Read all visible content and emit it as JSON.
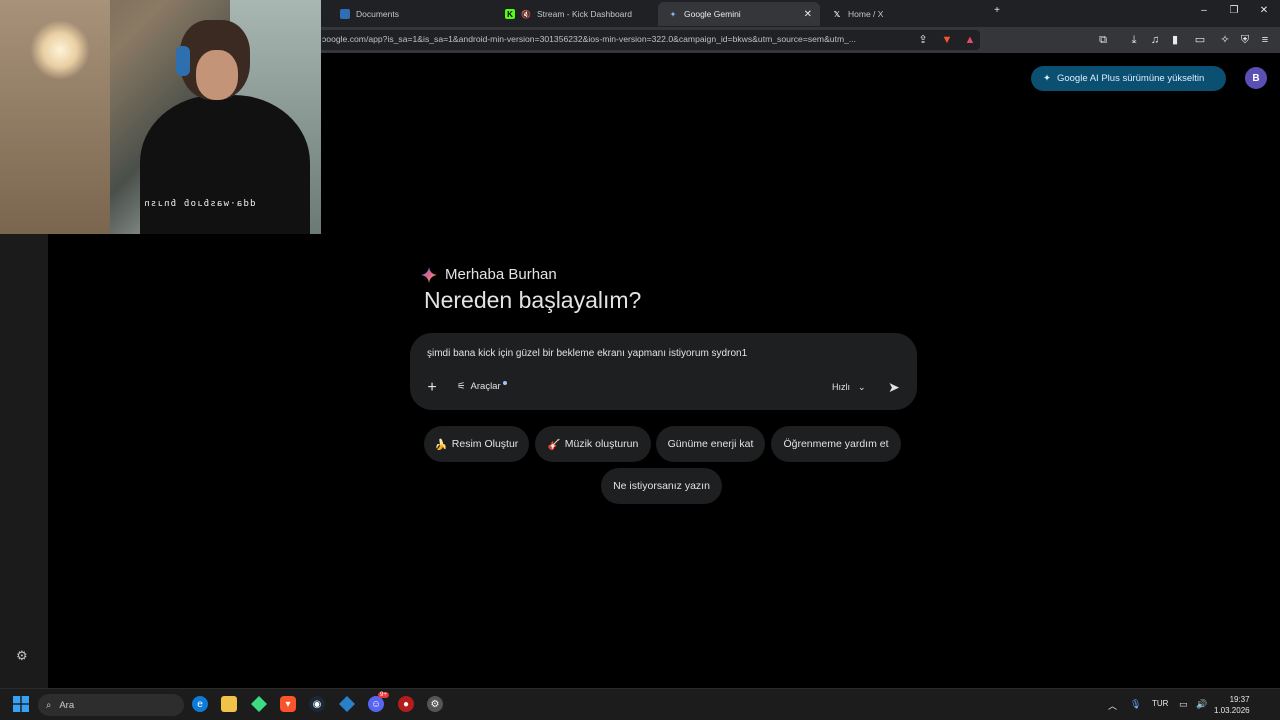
{
  "tabs": [
    {
      "label": "Documents",
      "active": false
    },
    {
      "label": "Stream - Kick Dashboard",
      "active": false
    },
    {
      "label": "Google Gemini",
      "active": true
    },
    {
      "label": "Home / X",
      "active": false
    }
  ],
  "window_controls": {
    "new_tab": "+",
    "minimize": "–",
    "restore": "❐",
    "close": "✕"
  },
  "address_bar": {
    "url": "ɔoogle.com/app?is_sa=1&is_sa=1&android-min-version=301356232&ios-min-version=322.0&campaign_id=bkws&utm_source=sem&utm_..."
  },
  "webcam": {
    "caption": "dda·wasɓɹoɓ ɓnɹsn"
  },
  "header": {
    "upgrade_label": "Google AI Plus sürümüne yükseltin",
    "avatar_letter": "B"
  },
  "main": {
    "greeting": "Merhaba Burhan",
    "headline": "Nereden başlayalım?",
    "prompt_text": "şimdi bana kick için güzel bir bekleme ekranı yapmanı istiyorum sydron1",
    "tools_label": "Araçlar",
    "mode_label": "Hızlı",
    "chips": [
      {
        "icon": "🍌",
        "label": "Resim Oluştur"
      },
      {
        "icon": "🎸",
        "label": "Müzik oluşturun"
      },
      {
        "icon": "",
        "label": "Günüme enerji kat"
      },
      {
        "icon": "",
        "label": "Öğrenmeme yardım et"
      },
      {
        "icon": "",
        "label": "Ne istiyorsanız yazın"
      }
    ]
  },
  "taskbar": {
    "search_placeholder": "Ara",
    "language": "TUR",
    "time": "19:37",
    "date": "1.03.2026",
    "discord_badge": "9+"
  }
}
